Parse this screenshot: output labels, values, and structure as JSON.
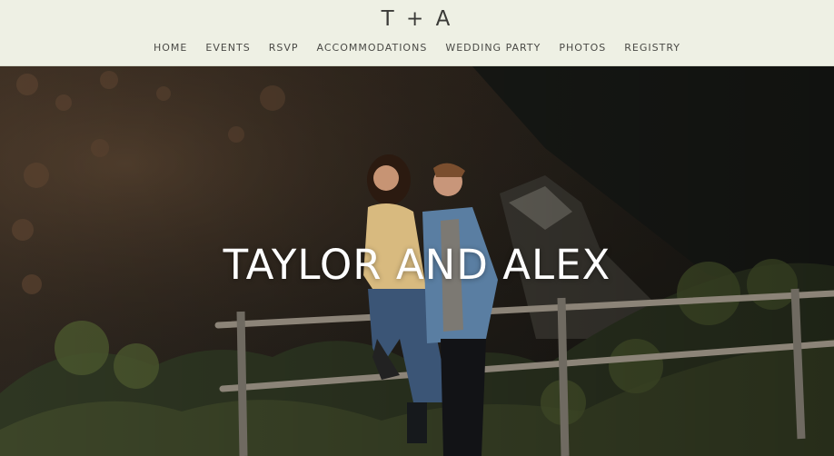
{
  "site": {
    "logo": "T + A"
  },
  "nav": {
    "items": [
      {
        "label": "HOME"
      },
      {
        "label": "EVENTS"
      },
      {
        "label": "RSVP"
      },
      {
        "label": "ACCOMMODATIONS"
      },
      {
        "label": "WEDDING PARTY"
      },
      {
        "label": "PHOTOS"
      },
      {
        "label": "REGISTRY"
      }
    ]
  },
  "hero": {
    "title": "TAYLOR AND ALEX"
  },
  "colors": {
    "header_bg": "#eef0e4",
    "nav_text": "#4a4a46",
    "hero_title": "#ffffff"
  }
}
